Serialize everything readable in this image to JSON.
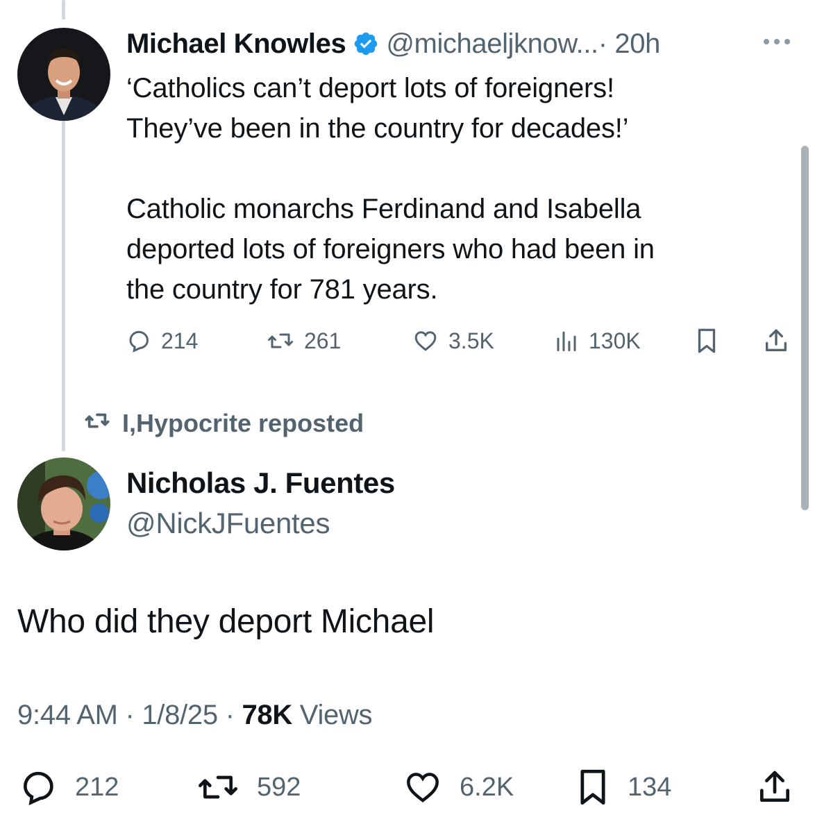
{
  "quoted_tweet": {
    "author_name": "Michael Knowles",
    "handle": "@michaeljknow...",
    "time": "· 20h",
    "verified": true,
    "text_paragraph_1": "‘Catholics can’t deport lots of foreigners!\nThey’ve been in the country for decades!’",
    "text_paragraph_2": "Catholic monarchs Ferdinand and Isabella\ndeported lots of foreigners who had been in\nthe country for 781 years.",
    "stats": {
      "replies": "214",
      "reposts": "261",
      "likes": "3.5K",
      "views": "130K"
    }
  },
  "repost_banner": {
    "label": "I,Hypocrite reposted"
  },
  "main_tweet": {
    "author_name": "Nicholas J. Fuentes",
    "handle": "@NickJFuentes",
    "text": "Who did they deport Michael",
    "time": "9:44 AM",
    "date": "1/8/25",
    "separator": "·",
    "views_count": "78K",
    "views_label": "Views",
    "stats": {
      "replies": "212",
      "reposts": "592",
      "likes": "6.2K",
      "bookmarks": "134"
    }
  },
  "colors": {
    "primary_text": "#0f1419",
    "secondary_text": "#536471",
    "verified_blue": "#1d9bf0",
    "thread_line": "#cfd9de"
  },
  "icons": [
    "verified-badge-icon",
    "more-icon",
    "reply-icon",
    "repost-icon",
    "like-icon",
    "views-icon",
    "bookmark-icon",
    "share-icon"
  ]
}
